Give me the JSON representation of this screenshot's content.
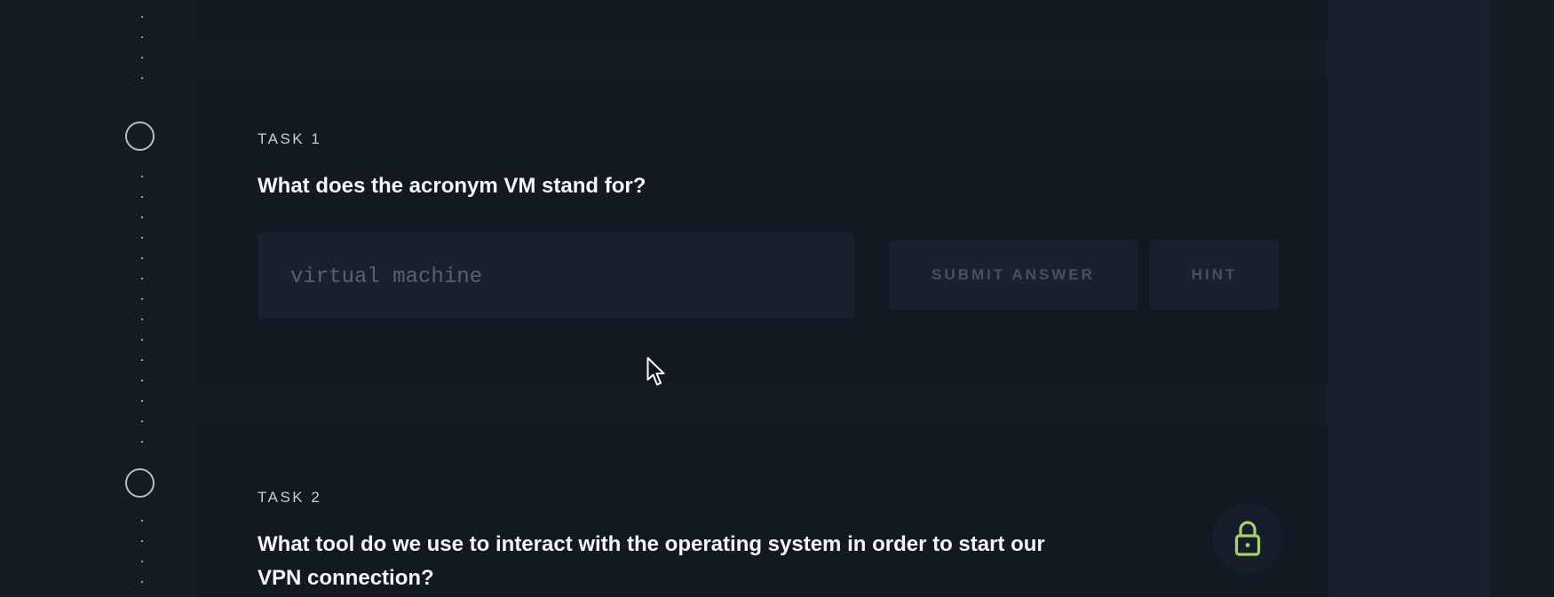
{
  "tasks": [
    {
      "label": "TASK 1",
      "question": "What does the acronym VM stand for?",
      "answer_value": "virtual machine",
      "submit_label": "SUBMIT ANSWER",
      "hint_label": "HINT"
    },
    {
      "label": "TASK 2",
      "question_line1": "What tool do we use to interact with the operating system in order to start our",
      "question_line2": "VPN connection?",
      "locked": true
    }
  ],
  "colors": {
    "accent": "#a3d16a",
    "background": "#161c26",
    "card": "#121923"
  },
  "icons": {
    "lock": "lock-icon",
    "cursor": "mouse-pointer"
  }
}
